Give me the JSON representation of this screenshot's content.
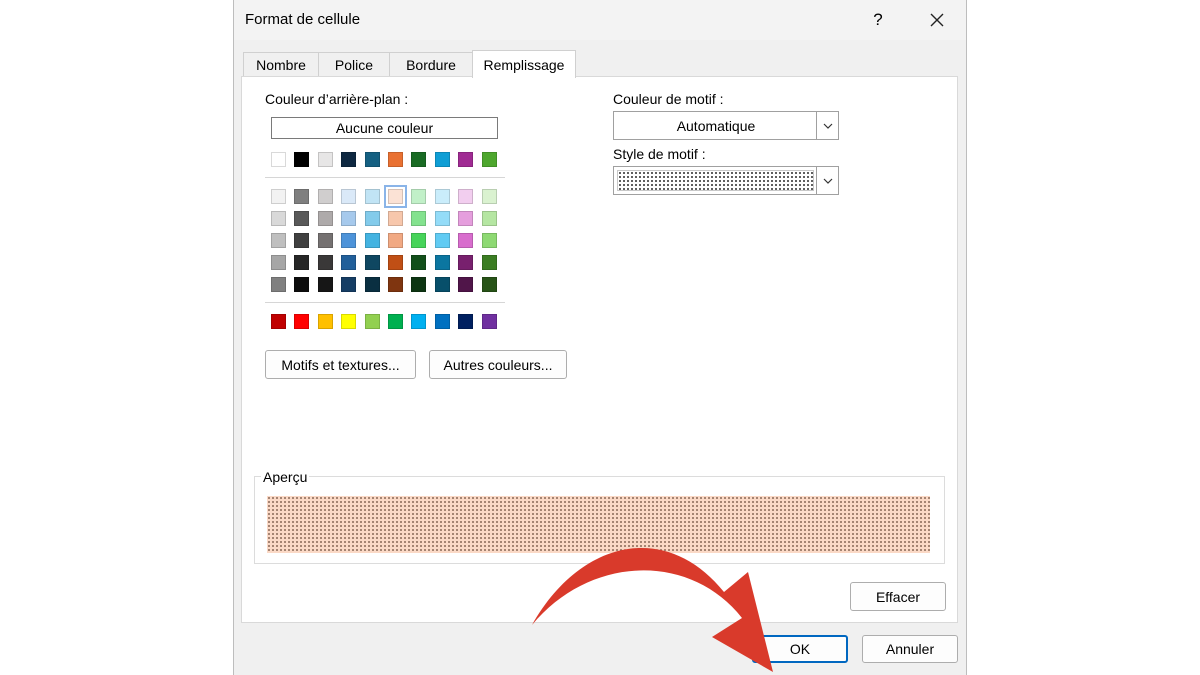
{
  "window": {
    "title": "Format de cellule",
    "help_glyph": "?",
    "close_icon": "close-icon"
  },
  "tabs": [
    {
      "label": "Nombre"
    },
    {
      "label": "Police"
    },
    {
      "label": "Bordure"
    },
    {
      "label": "Remplissage",
      "active": true
    }
  ],
  "background": {
    "label": "Couleur d’arrière-plan :",
    "label_accel_char": "o",
    "no_color_label": "Aucune couleur",
    "theme_top_row": [
      "#ffffff",
      "#000000",
      "#e7e6e6",
      "#0e2841",
      "#156082",
      "#e97132",
      "#196b24",
      "#0f9ed5",
      "#a02b93",
      "#4ea72e"
    ],
    "theme_shades": [
      [
        "#f2f2f2",
        "#7f7f7f",
        "#d0cece",
        "#dae9f8",
        "#c1e4f5",
        "#fbe2d5",
        "#c1f0c8",
        "#caedfb",
        "#f2ceef",
        "#daf2d0"
      ],
      [
        "#d9d9d9",
        "#595959",
        "#aeaaaa",
        "#a6c9ec",
        "#83cbeb",
        "#f7c7ac",
        "#83e28e",
        "#94dcf8",
        "#e59edd",
        "#b5e6a2"
      ],
      [
        "#bfbfbf",
        "#404040",
        "#757171",
        "#4d93d9",
        "#44b3e1",
        "#f1a983",
        "#47d45a",
        "#61cbf3",
        "#d86dcd",
        "#8ed973"
      ],
      [
        "#a6a6a6",
        "#262626",
        "#3a3838",
        "#215f9a",
        "#0f4761",
        "#c04f15",
        "#124f1a",
        "#0b76a0",
        "#78206e",
        "#3b7d23"
      ],
      [
        "#808080",
        "#0d0d0d",
        "#161616",
        "#153d64",
        "#0a2f41",
        "#7f3510",
        "#0d3512",
        "#074f6a",
        "#501549",
        "#275317"
      ]
    ],
    "standard_colors": [
      "#c00000",
      "#ff0000",
      "#ffc000",
      "#ffff00",
      "#92d050",
      "#00b050",
      "#00b0f0",
      "#0070c0",
      "#002060",
      "#7030a0"
    ],
    "selected_color": "#fbe2d5",
    "buttons": {
      "patterns": "Motifs et textures...",
      "more_colors": "Autres couleurs..."
    }
  },
  "pattern": {
    "color_label": "Couleur de motif :",
    "color_value": "Automatique",
    "style_label": "Style de motif :",
    "style_value": "dotted-pattern"
  },
  "preview": {
    "label": "Aperçu",
    "fill_color": "#fbd9c6"
  },
  "buttons": {
    "clear": "Effacer",
    "ok": "OK",
    "cancel": "Annuler"
  },
  "overlay": {
    "arrow_color": "#d93a2b",
    "arrow_icon": "curved-arrow-icon"
  }
}
